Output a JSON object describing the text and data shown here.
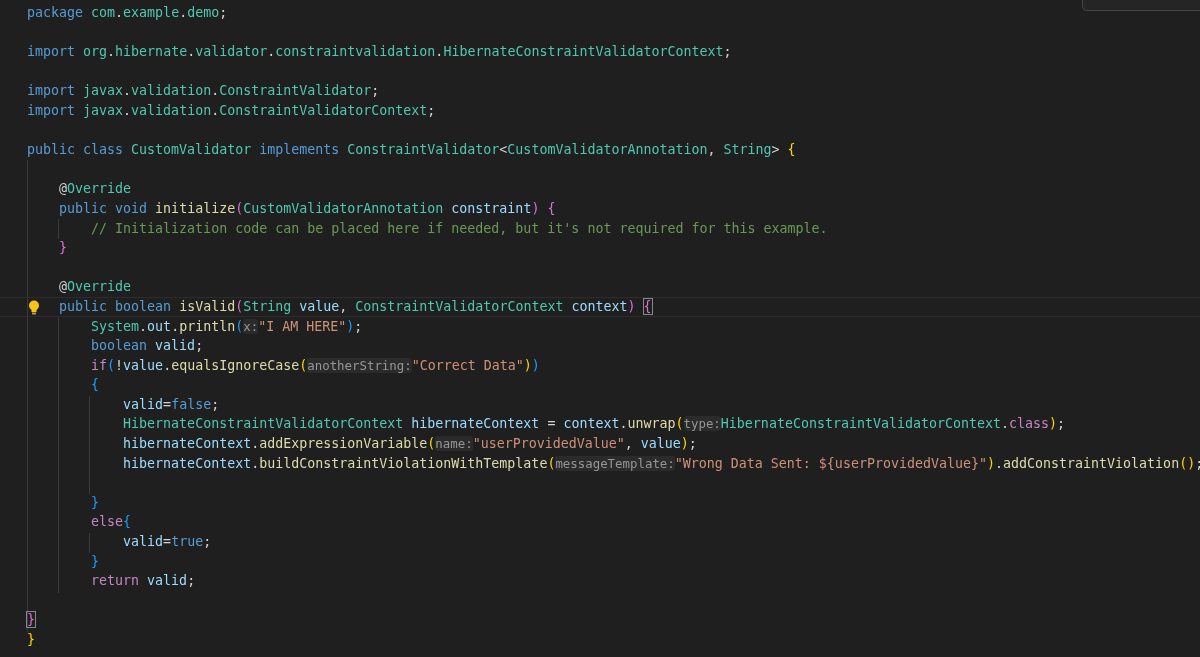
{
  "editor": {
    "lines": [
      {
        "kind": "code",
        "current": false,
        "lightbulb": false,
        "tokens": [
          {
            "text": "package ",
            "kind": "kw"
          },
          {
            "text": "com",
            "kind": "ty"
          },
          {
            "text": ".",
            "kind": "p"
          },
          {
            "text": "example",
            "kind": "ty"
          },
          {
            "text": ".",
            "kind": "p"
          },
          {
            "text": "demo",
            "kind": "ty"
          },
          {
            "text": ";",
            "kind": "p"
          }
        ]
      },
      {
        "kind": "blank"
      },
      {
        "kind": "code",
        "current": false,
        "lightbulb": false,
        "tokens": [
          {
            "text": "import ",
            "kind": "kw"
          },
          {
            "text": "org",
            "kind": "ty"
          },
          {
            "text": ".",
            "kind": "p"
          },
          {
            "text": "hibernate",
            "kind": "ty"
          },
          {
            "text": ".",
            "kind": "p"
          },
          {
            "text": "validator",
            "kind": "ty"
          },
          {
            "text": ".",
            "kind": "p"
          },
          {
            "text": "constraintvalidation",
            "kind": "ty"
          },
          {
            "text": ".",
            "kind": "p"
          },
          {
            "text": "HibernateConstraintValidatorContext",
            "kind": "ty"
          },
          {
            "text": ";",
            "kind": "p"
          }
        ]
      },
      {
        "kind": "blank"
      },
      {
        "kind": "code",
        "current": false,
        "lightbulb": false,
        "tokens": [
          {
            "text": "import ",
            "kind": "kw"
          },
          {
            "text": "javax",
            "kind": "ty"
          },
          {
            "text": ".",
            "kind": "p"
          },
          {
            "text": "validation",
            "kind": "ty"
          },
          {
            "text": ".",
            "kind": "p"
          },
          {
            "text": "ConstraintValidator",
            "kind": "ty"
          },
          {
            "text": ";",
            "kind": "p"
          }
        ]
      },
      {
        "kind": "code",
        "current": false,
        "lightbulb": false,
        "tokens": [
          {
            "text": "import ",
            "kind": "kw"
          },
          {
            "text": "javax",
            "kind": "ty"
          },
          {
            "text": ".",
            "kind": "p"
          },
          {
            "text": "validation",
            "kind": "ty"
          },
          {
            "text": ".",
            "kind": "p"
          },
          {
            "text": "ConstraintValidatorContext",
            "kind": "ty"
          },
          {
            "text": ";",
            "kind": "p"
          }
        ]
      },
      {
        "kind": "blank"
      },
      {
        "kind": "code",
        "current": false,
        "lightbulb": false,
        "tokens": [
          {
            "text": "public class ",
            "kind": "kw"
          },
          {
            "text": "CustomValidator ",
            "kind": "ty"
          },
          {
            "text": "implements ",
            "kind": "kw"
          },
          {
            "text": "ConstraintValidator",
            "kind": "ty"
          },
          {
            "text": "<",
            "kind": "p"
          },
          {
            "text": "CustomValidatorAnnotation",
            "kind": "ty"
          },
          {
            "text": ", ",
            "kind": "p"
          },
          {
            "text": "String",
            "kind": "ty"
          },
          {
            "text": "> ",
            "kind": "p"
          },
          {
            "text": "{",
            "kind": "b1"
          }
        ]
      },
      {
        "kind": "blank"
      },
      {
        "kind": "code",
        "current": false,
        "lightbulb": false,
        "tokens": [
          {
            "text": "    @",
            "kind": "p"
          },
          {
            "text": "Override",
            "kind": "ty"
          }
        ]
      },
      {
        "kind": "code",
        "current": false,
        "lightbulb": false,
        "tokens": [
          {
            "text": "    public void ",
            "kind": "kw"
          },
          {
            "text": "initialize",
            "kind": "fn"
          },
          {
            "text": "(",
            "kind": "b2"
          },
          {
            "text": "CustomValidatorAnnotation ",
            "kind": "ty"
          },
          {
            "text": "constraint",
            "kind": "var"
          },
          {
            "text": ") ",
            "kind": "b2"
          },
          {
            "text": "{",
            "kind": "b2"
          }
        ]
      },
      {
        "kind": "code",
        "current": false,
        "lightbulb": false,
        "tokens": [
          {
            "text": "        // Initialization code can be placed here if needed, but it's not required for this example.",
            "kind": "cm"
          }
        ]
      },
      {
        "kind": "code",
        "current": false,
        "lightbulb": false,
        "tokens": [
          {
            "text": "    }",
            "kind": "b2"
          }
        ]
      },
      {
        "kind": "blank"
      },
      {
        "kind": "code",
        "current": false,
        "lightbulb": false,
        "tokens": [
          {
            "text": "    @",
            "kind": "p"
          },
          {
            "text": "Override",
            "kind": "ty"
          }
        ]
      },
      {
        "kind": "code",
        "current": true,
        "lightbulb": true,
        "tokens": [
          {
            "text": "    public boolean ",
            "kind": "kw"
          },
          {
            "text": "isValid",
            "kind": "fn"
          },
          {
            "text": "(",
            "kind": "b2"
          },
          {
            "text": "String ",
            "kind": "ty"
          },
          {
            "text": "value",
            "kind": "var"
          },
          {
            "text": ", ",
            "kind": "p"
          },
          {
            "text": "ConstraintValidatorContext ",
            "kind": "ty"
          },
          {
            "text": "context",
            "kind": "var"
          },
          {
            "text": ") ",
            "kind": "b2"
          },
          {
            "text": "{",
            "kind": "b2",
            "boxed": true
          }
        ]
      },
      {
        "kind": "code",
        "current": false,
        "lightbulb": false,
        "tokens": [
          {
            "text": "        System",
            "kind": "ty"
          },
          {
            "text": ".",
            "kind": "p"
          },
          {
            "text": "out",
            "kind": "var"
          },
          {
            "text": ".",
            "kind": "p"
          },
          {
            "text": "println",
            "kind": "fn"
          },
          {
            "text": "(",
            "kind": "b3"
          },
          {
            "text": "x:",
            "kind": "hint"
          },
          {
            "text": "\"I AM HERE\"",
            "kind": "str"
          },
          {
            "text": ")",
            "kind": "b3"
          },
          {
            "text": ";",
            "kind": "p"
          }
        ]
      },
      {
        "kind": "code",
        "current": false,
        "lightbulb": false,
        "tokens": [
          {
            "text": "        boolean ",
            "kind": "kw"
          },
          {
            "text": "valid",
            "kind": "var"
          },
          {
            "text": ";",
            "kind": "p"
          }
        ]
      },
      {
        "kind": "code",
        "current": false,
        "lightbulb": false,
        "tokens": [
          {
            "text": "        if",
            "kind": "ctl"
          },
          {
            "text": "(",
            "kind": "b3"
          },
          {
            "text": "!",
            "kind": "p"
          },
          {
            "text": "value",
            "kind": "var"
          },
          {
            "text": ".",
            "kind": "p"
          },
          {
            "text": "equalsIgnoreCase",
            "kind": "fn"
          },
          {
            "text": "(",
            "kind": "b1"
          },
          {
            "text": "anotherString:",
            "kind": "hint"
          },
          {
            "text": "\"Correct Data\"",
            "kind": "str"
          },
          {
            "text": ")",
            "kind": "b1"
          },
          {
            "text": ")",
            "kind": "b3"
          }
        ]
      },
      {
        "kind": "code",
        "current": false,
        "lightbulb": false,
        "tokens": [
          {
            "text": "        {",
            "kind": "b3"
          }
        ]
      },
      {
        "kind": "code",
        "current": false,
        "lightbulb": false,
        "tokens": [
          {
            "text": "            valid",
            "kind": "var"
          },
          {
            "text": "=",
            "kind": "p"
          },
          {
            "text": "false",
            "kind": "kw"
          },
          {
            "text": ";",
            "kind": "p"
          }
        ]
      },
      {
        "kind": "code",
        "current": false,
        "lightbulb": false,
        "tokens": [
          {
            "text": "            HibernateConstraintValidatorContext ",
            "kind": "ty"
          },
          {
            "text": "hibernateContext",
            "kind": "var"
          },
          {
            "text": " = ",
            "kind": "p"
          },
          {
            "text": "context",
            "kind": "var"
          },
          {
            "text": ".",
            "kind": "p"
          },
          {
            "text": "unwrap",
            "kind": "fn"
          },
          {
            "text": "(",
            "kind": "b1"
          },
          {
            "text": "type:",
            "kind": "hint"
          },
          {
            "text": "HibernateConstraintValidatorContext",
            "kind": "ty"
          },
          {
            "text": ".",
            "kind": "p"
          },
          {
            "text": "class",
            "kind": "ctl"
          },
          {
            "text": ")",
            "kind": "b1"
          },
          {
            "text": ";",
            "kind": "p"
          }
        ]
      },
      {
        "kind": "code",
        "current": false,
        "lightbulb": false,
        "tokens": [
          {
            "text": "            hibernateContext",
            "kind": "var"
          },
          {
            "text": ".",
            "kind": "p"
          },
          {
            "text": "addExpressionVariable",
            "kind": "fn"
          },
          {
            "text": "(",
            "kind": "b1"
          },
          {
            "text": "name:",
            "kind": "hint"
          },
          {
            "text": "\"userProvidedValue\"",
            "kind": "str"
          },
          {
            "text": ", ",
            "kind": "p"
          },
          {
            "text": "value",
            "kind": "var"
          },
          {
            "text": ")",
            "kind": "b1"
          },
          {
            "text": ";",
            "kind": "p"
          }
        ]
      },
      {
        "kind": "code",
        "current": false,
        "lightbulb": false,
        "tokens": [
          {
            "text": "            hibernateContext",
            "kind": "var"
          },
          {
            "text": ".",
            "kind": "p"
          },
          {
            "text": "buildConstraintViolationWithTemplate",
            "kind": "fn"
          },
          {
            "text": "(",
            "kind": "b1"
          },
          {
            "text": "messageTemplate:",
            "kind": "hint"
          },
          {
            "text": "\"Wrong Data Sent: ${userProvidedValue}\"",
            "kind": "str"
          },
          {
            "text": ")",
            "kind": "b1"
          },
          {
            "text": ".",
            "kind": "p"
          },
          {
            "text": "addConstraintViolation",
            "kind": "fn"
          },
          {
            "text": "()",
            "kind": "b1"
          },
          {
            "text": ";",
            "kind": "p"
          }
        ]
      },
      {
        "kind": "blank"
      },
      {
        "kind": "code",
        "current": false,
        "lightbulb": false,
        "tokens": [
          {
            "text": "        }",
            "kind": "b3"
          }
        ]
      },
      {
        "kind": "code",
        "current": false,
        "lightbulb": false,
        "tokens": [
          {
            "text": "        else",
            "kind": "ctl"
          },
          {
            "text": "{",
            "kind": "b3"
          }
        ]
      },
      {
        "kind": "code",
        "current": false,
        "lightbulb": false,
        "tokens": [
          {
            "text": "            valid",
            "kind": "var"
          },
          {
            "text": "=",
            "kind": "p"
          },
          {
            "text": "true",
            "kind": "kw"
          },
          {
            "text": ";",
            "kind": "p"
          }
        ]
      },
      {
        "kind": "code",
        "current": false,
        "lightbulb": false,
        "tokens": [
          {
            "text": "        }",
            "kind": "b3"
          }
        ]
      },
      {
        "kind": "code",
        "current": false,
        "lightbulb": false,
        "tokens": [
          {
            "text": "        return ",
            "kind": "ctl"
          },
          {
            "text": "valid",
            "kind": "var"
          },
          {
            "text": ";",
            "kind": "p"
          }
        ]
      },
      {
        "kind": "blank"
      },
      {
        "kind": "code",
        "current": false,
        "lightbulb": false,
        "tokens": [
          {
            "text": "}",
            "kind": "b2",
            "boxed": true
          }
        ]
      },
      {
        "kind": "code",
        "current": false,
        "lightbulb": false,
        "tokens": [
          {
            "text": "}",
            "kind": "b1"
          }
        ]
      }
    ]
  }
}
